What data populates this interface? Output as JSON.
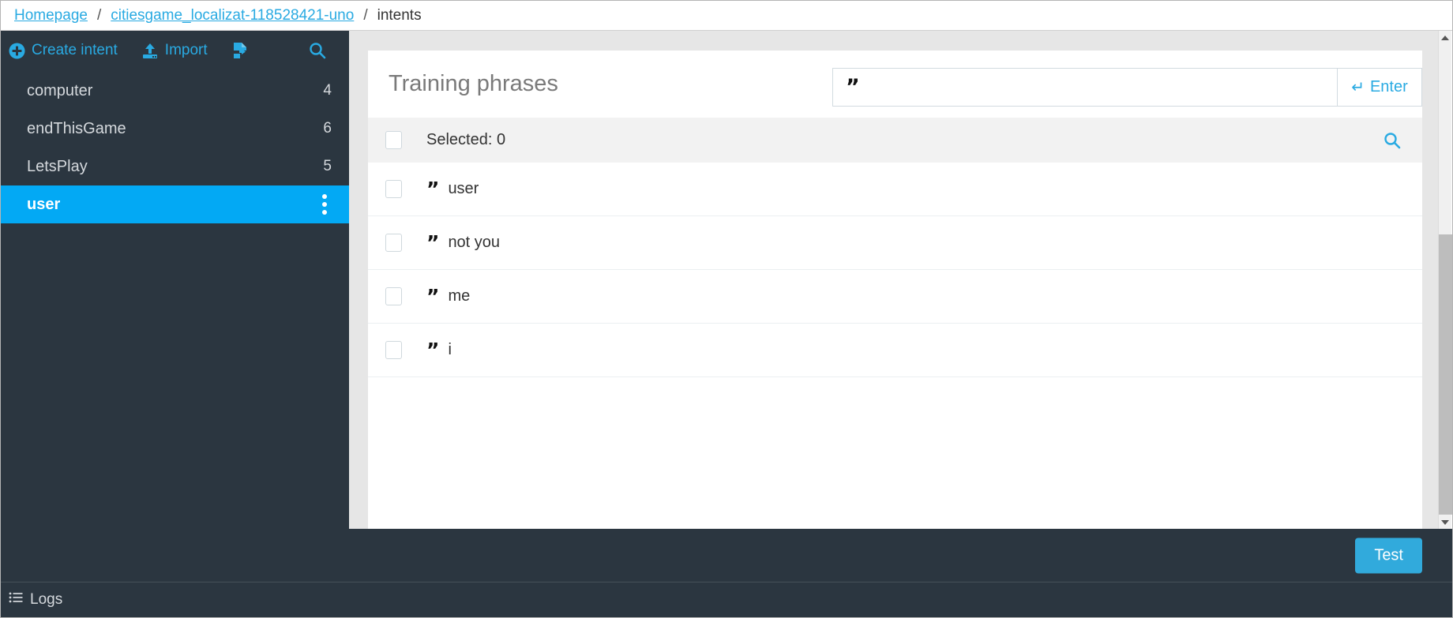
{
  "breadcrumb": {
    "items": [
      {
        "label": "Homepage",
        "link": true
      },
      {
        "label": "citiesgame_localizat-118528421-uno",
        "link": true
      },
      {
        "label": "intents",
        "link": false
      }
    ],
    "separator": "/"
  },
  "sidebar": {
    "toolbar": {
      "create_label": "Create intent",
      "create_icon": "plus-circle-icon",
      "import_label": "Import",
      "import_icon": "upload-icon",
      "export_icon": "export-file-icon",
      "search_icon": "search-icon"
    },
    "intents": [
      {
        "name": "computer",
        "count": "4",
        "selected": false
      },
      {
        "name": "endThisGame",
        "count": "6",
        "selected": false
      },
      {
        "name": "LetsPlay",
        "count": "5",
        "selected": false
      },
      {
        "name": "user",
        "count": "",
        "selected": true
      }
    ],
    "selected_menu_icon": "kebab-menu-icon"
  },
  "main": {
    "title": "Training phrases",
    "new_phrase": {
      "value": "",
      "placeholder": "",
      "quote_glyph": "”",
      "enter_label": "Enter",
      "enter_icon": "return-arrow-icon",
      "enter_glyph": "↵"
    },
    "select_bar": {
      "label": "Selected: 0",
      "checked": false,
      "search_icon": "search-icon"
    },
    "phrases": [
      {
        "text": "user",
        "checked": false
      },
      {
        "text": "not you",
        "checked": false
      },
      {
        "text": "me",
        "checked": false
      },
      {
        "text": "i",
        "checked": false
      }
    ],
    "phrase_quote_glyph": "”"
  },
  "footer": {
    "test_label": "Test"
  },
  "logbar": {
    "label": "Logs",
    "icon": "list-icon"
  },
  "scrollbar": {
    "up_icon": "chevron-up-icon",
    "down_icon": "chevron-down-icon"
  },
  "colors": {
    "accent_blue": "#29aae2",
    "selected_blue": "#03a9f4",
    "dark_panel": "#2b3640",
    "test_button": "#31aadc"
  }
}
